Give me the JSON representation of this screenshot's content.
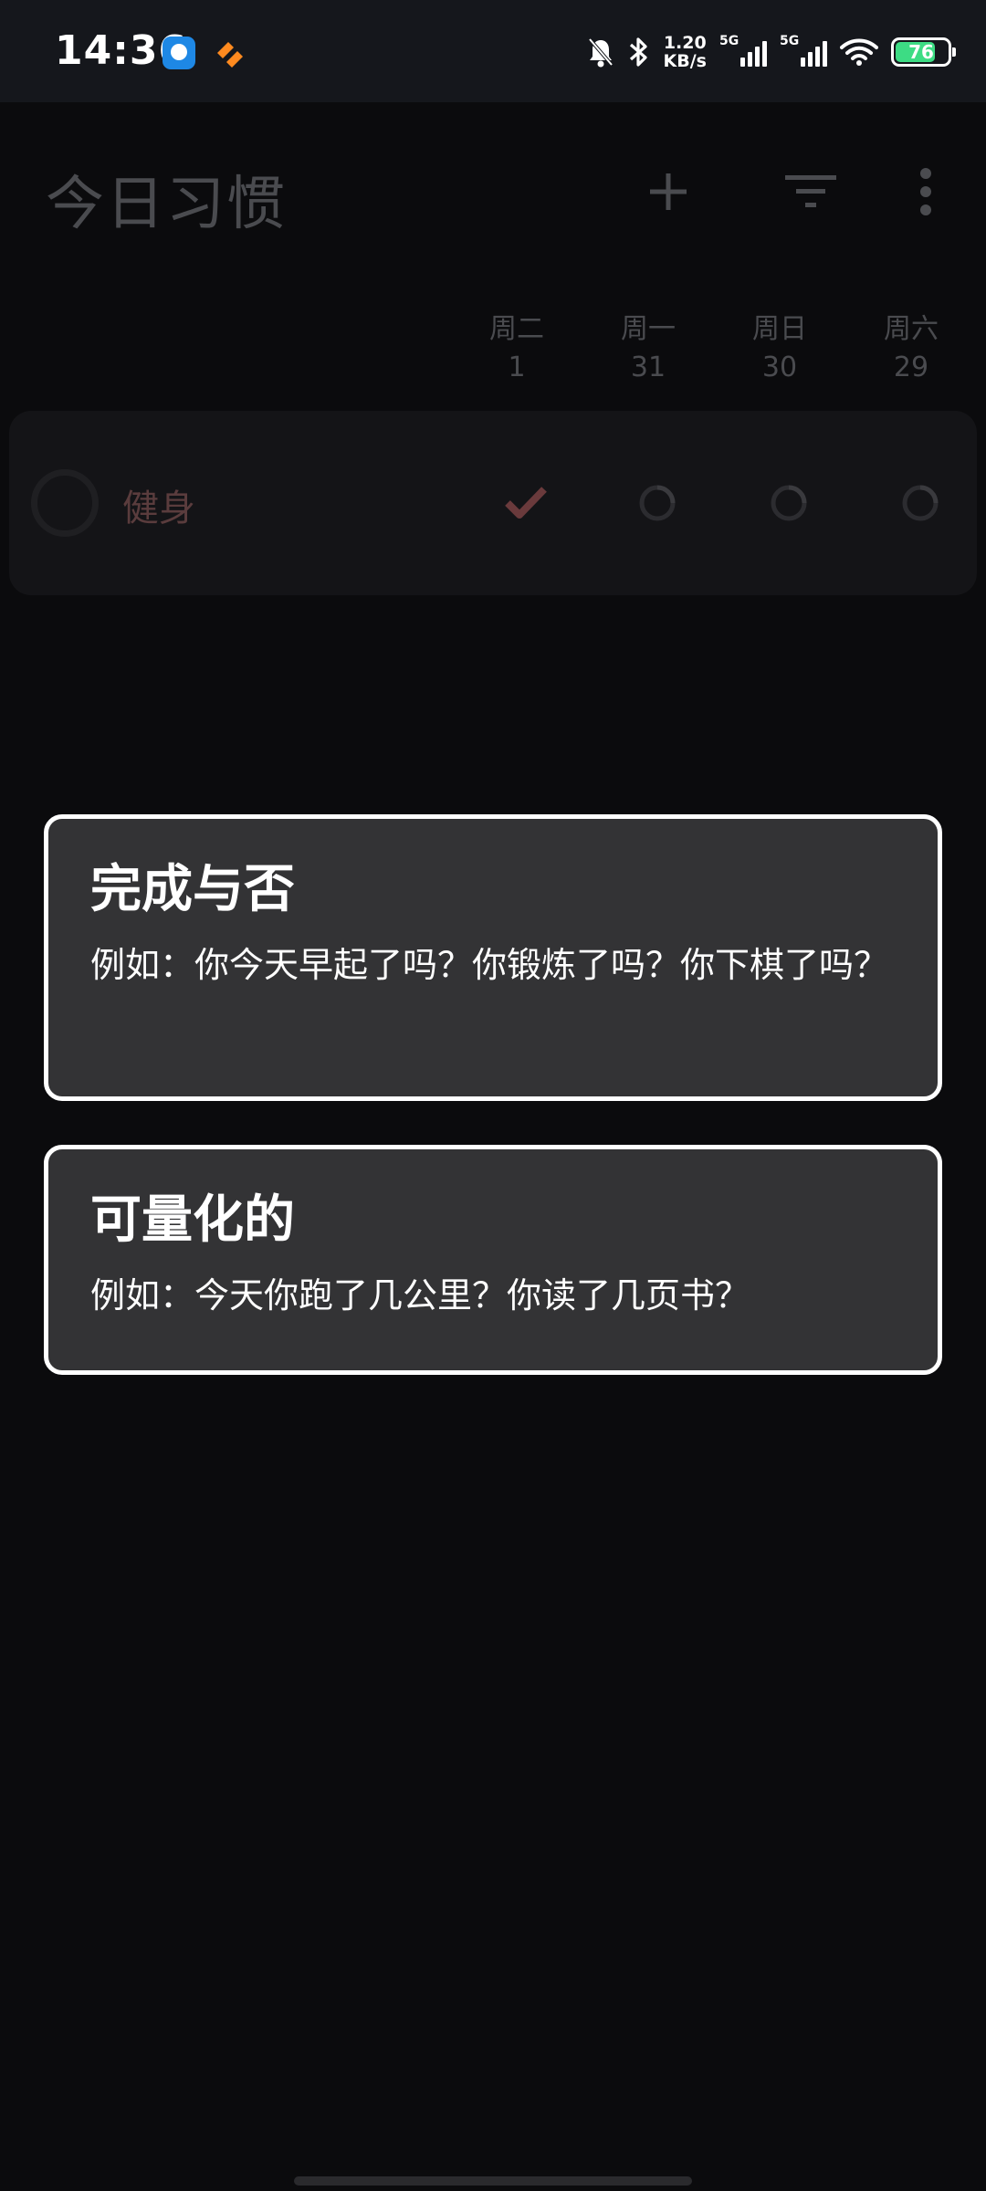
{
  "status_bar": {
    "time": "14:36",
    "net_speed_value": "1.20",
    "net_speed_unit": "KB/s",
    "sim1_label": "5G",
    "sim2_label": "5G",
    "battery_level": "76",
    "battery_fraction": 0.76,
    "battery_color": "#3ddc84"
  },
  "app_bar": {
    "title": "今日习惯",
    "add_icon": "plus-icon",
    "filter_icon": "filter-icon",
    "more_icon": "more-vertical-icon"
  },
  "day_header": [
    {
      "weekday": "周二",
      "date": "1"
    },
    {
      "weekday": "周一",
      "date": "31"
    },
    {
      "weekday": "周日",
      "date": "30"
    },
    {
      "weekday": "周六",
      "date": "29"
    }
  ],
  "habits": [
    {
      "name": "健身",
      "color": "#5a3c3d",
      "marks": [
        "check",
        "empty",
        "empty",
        "empty"
      ]
    }
  ],
  "dialog": {
    "options": [
      {
        "title": "完成与否",
        "description": "例如：你今天早起了吗？你锻炼了吗？你下棋了吗？"
      },
      {
        "title": "可量化的",
        "description": "例如：今天你跑了几公里？你读了几页书？"
      }
    ]
  }
}
